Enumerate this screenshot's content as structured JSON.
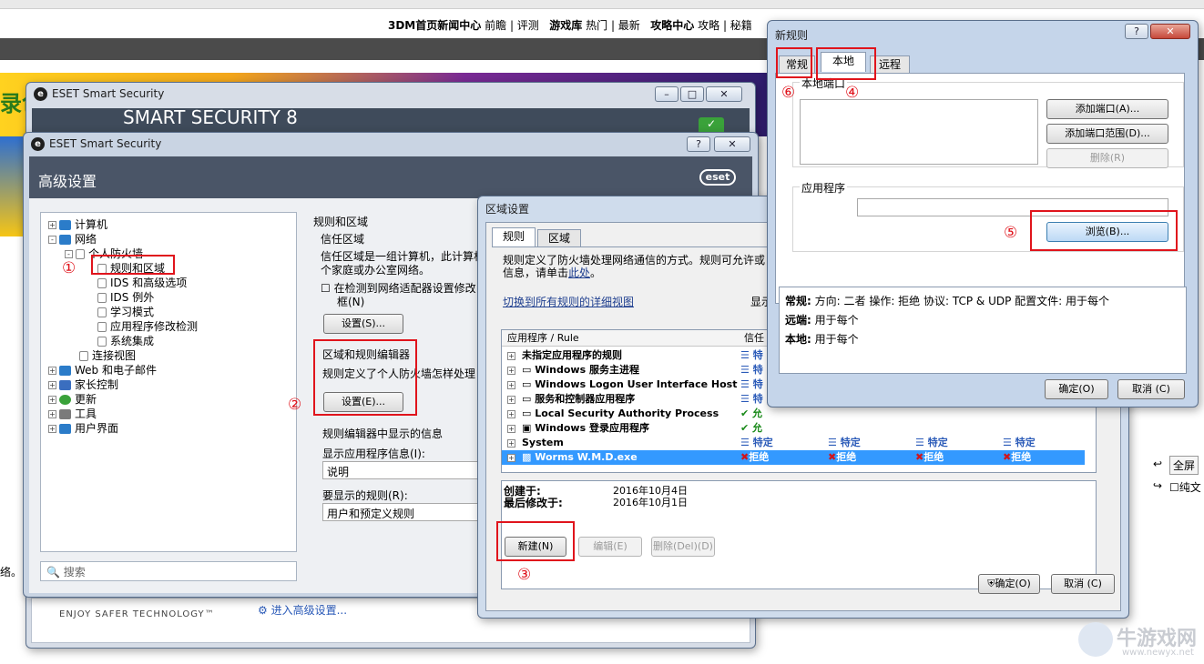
{
  "site": {
    "nav_items": [
      "3DM首页",
      "新闻中心",
      "前瞻",
      "评测",
      "游戏库",
      "热门",
      "最新",
      "攻略中心",
      "攻略",
      "秘籍"
    ],
    "banner_text": "录色",
    "right_buttons": [
      "全屏",
      "纯文"
    ],
    "left_fragment": "络。",
    "watermark": {
      "title": "牛游戏网",
      "url": "www.newyx.net"
    }
  },
  "eset_back": {
    "title": "ESET Smart Security",
    "header": "SMART SECURITY 8",
    "slogan": "ENJOY SAFER TECHNOLOGY™",
    "advanced_link": "进入高级设置..."
  },
  "advanced": {
    "title": "ESET Smart Security",
    "header": "高级设置",
    "logo": "eset",
    "tree": [
      {
        "label": "计算机",
        "depth": 0,
        "expander": "+"
      },
      {
        "label": "网络",
        "depth": 0,
        "expander": "-"
      },
      {
        "label": "个人防火墙",
        "depth": 1,
        "expander": "-"
      },
      {
        "label": "规则和区域",
        "depth": 2,
        "expander": ""
      },
      {
        "label": "IDS 和高级选项",
        "depth": 2,
        "expander": ""
      },
      {
        "label": "IDS 例外",
        "depth": 2,
        "expander": ""
      },
      {
        "label": "学习模式",
        "depth": 2,
        "expander": ""
      },
      {
        "label": "应用程序修改检测",
        "depth": 2,
        "expander": ""
      },
      {
        "label": "系统集成",
        "depth": 2,
        "expander": ""
      },
      {
        "label": "连接视图",
        "depth": 1,
        "expander": ""
      },
      {
        "label": "Web 和电子邮件",
        "depth": 0,
        "expander": "+"
      },
      {
        "label": "家长控制",
        "depth": 0,
        "expander": "+"
      },
      {
        "label": "更新",
        "depth": 0,
        "expander": "+"
      },
      {
        "label": "工具",
        "depth": 0,
        "expander": "+"
      },
      {
        "label": "用户界面",
        "depth": 0,
        "expander": "+"
      }
    ],
    "search_placeholder": "搜索",
    "section_title": "规则和区域",
    "trusted_zone": {
      "heading": "信任区域",
      "desc_line1": "信任区域是一组计算机，此计算机",
      "desc_line2": "个家庭或办公室网络。",
      "checkbox_label_line1": "在检测到网络适配器设置修改",
      "checkbox_label_line2": "框(N)",
      "settings_button": "设置(S)..."
    },
    "rule_editor": {
      "heading": "区域和规则编辑器",
      "desc": "规则定义了个人防火墙怎样处理",
      "settings_button": "设置(E)..."
    },
    "display_info": {
      "heading": "规则编辑器中显示的信息",
      "app_info_label": "显示应用程序信息(I):",
      "app_info_value": "说明",
      "rules_label": "要显示的规则(R):",
      "rules_value": "用户和预定义规则"
    }
  },
  "zone": {
    "title": "区域设置",
    "tabs": [
      "规则",
      "区域"
    ],
    "desc_line1": "规则定义了防火墙处理网络通信的方式。规则可允许或",
    "desc_line2_prefix": "信息，请单击",
    "desc_link": "此处",
    "desc_line2_suffix": "。",
    "detail_view_link": "切换到所有规则的详细视图",
    "display_col_partial": "显示",
    "col_app": "应用程序 / Rule",
    "col_trust": "信任",
    "rows": [
      {
        "name": "未指定应用程序的规则",
        "cells": [
          "特"
        ],
        "expander": "+"
      },
      {
        "name": "Windows 服务主进程",
        "cells": [
          "特"
        ],
        "expander": "+"
      },
      {
        "name": "Windows Logon User Interface Host",
        "cells": [
          "特"
        ],
        "expander": "+"
      },
      {
        "name": "服务和控制器应用程序",
        "cells": [
          "特"
        ],
        "expander": "+"
      },
      {
        "name": "Local Security Authority Process",
        "cells": [
          "允"
        ],
        "expander": "+"
      },
      {
        "name": "Windows 登录应用程序",
        "cells": [
          "允"
        ],
        "expander": "+"
      },
      {
        "name": "System",
        "cells": [
          "特定",
          "特定",
          "特定",
          "特定"
        ],
        "expander": "+"
      },
      {
        "name": "Worms W.M.D.exe",
        "cells": [
          "拒绝",
          "拒绝",
          "拒绝",
          "拒绝"
        ],
        "expander": "+",
        "selected": true
      }
    ],
    "created_label": "创建于:",
    "created_value": "2016年10月4日",
    "modified_label": "最后修改于:",
    "modified_value": "2016年10月1日",
    "new_button": "新建(N)",
    "edit_button": "编辑(E)",
    "delete_button": "删除(Del)(D)",
    "ok_button": "确定(O)",
    "cancel_button": "取消 (C)"
  },
  "newrule": {
    "title": "新规则",
    "tabs": [
      "常规",
      "本地",
      "远程"
    ],
    "local_port_label": "本地端口",
    "add_port_button": "添加端口(A)...",
    "add_port_range_button": "添加端口范围(D)...",
    "delete_button": "删除(R)",
    "app_label": "应用程序",
    "browse_button": "浏览(B)...",
    "info": {
      "general_label": "常规:",
      "general_value": "方向: 二者   操作: 拒绝   协议: TCP & UDP   配置文件: 用于每个",
      "remote_label": "远端:",
      "remote_value": "用于每个",
      "local_label": "本地:",
      "local_value": "用于每个"
    },
    "ok_button": "确定(O)",
    "cancel_button": "取消 (C)"
  },
  "annotations": [
    "①",
    "②",
    "③",
    "④",
    "⑤",
    "⑥"
  ],
  "colors": {
    "highlight_red": "#e0141c",
    "selection_blue": "#3399ff",
    "eset_header": "#4a5567"
  }
}
